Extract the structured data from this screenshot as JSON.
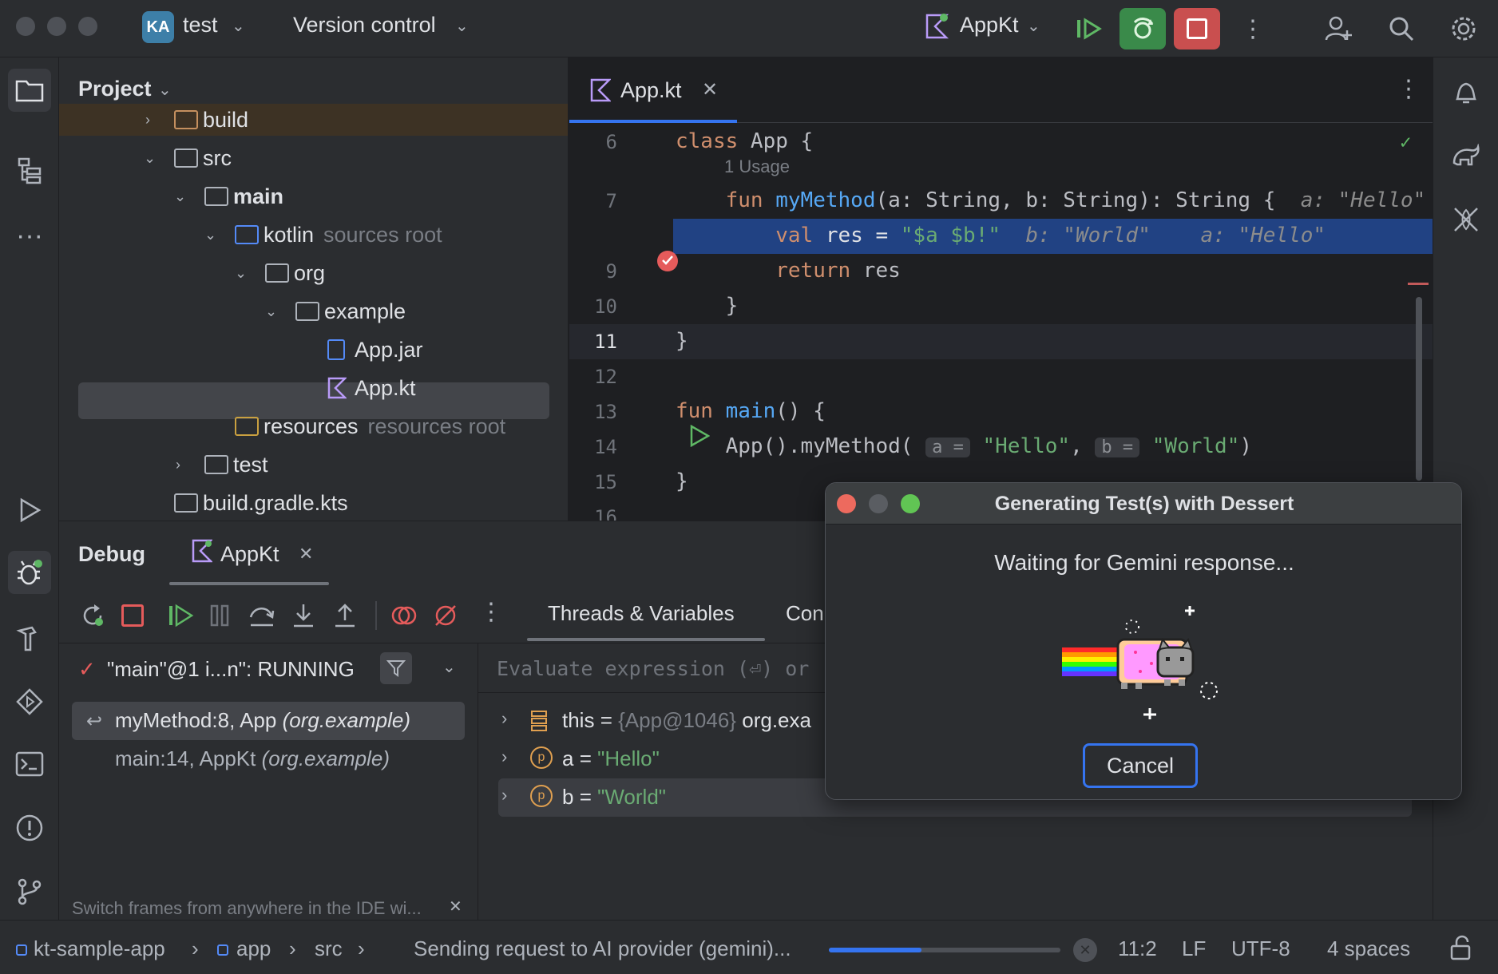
{
  "titlebar": {
    "project_badge": "KA",
    "project_name": "test",
    "vcs_label": "Version control",
    "run_config": "AppKt"
  },
  "project_panel": {
    "title": "Project",
    "tree": [
      {
        "label": "build",
        "hint": ""
      },
      {
        "label": "src",
        "hint": ""
      },
      {
        "label": "main",
        "hint": ""
      },
      {
        "label": "kotlin",
        "hint": "sources root"
      },
      {
        "label": "org",
        "hint": ""
      },
      {
        "label": "example",
        "hint": ""
      },
      {
        "label": "App.jar",
        "hint": ""
      },
      {
        "label": "App.kt",
        "hint": ""
      },
      {
        "label": "resources",
        "hint": "resources root"
      },
      {
        "label": "test",
        "hint": ""
      },
      {
        "label": "build.gradle.kts",
        "hint": ""
      }
    ]
  },
  "editor": {
    "tab_label": "App.kt",
    "usage_hint": "1 Usage",
    "lines": {
      "n6": "6",
      "n7": "7",
      "n9": "9",
      "n10": "10",
      "n11": "11",
      "n12": "12",
      "n13": "13",
      "n14": "14",
      "n15": "15",
      "n16": "16"
    },
    "inline_hints": {
      "l7_a": "a: \"Hello\"",
      "l8_b": "b: \"World\"",
      "l8_a": "a: \"Hello\"",
      "l14_a": "a =",
      "l14_b": "b ="
    }
  },
  "debug": {
    "title": "Debug",
    "session_tab": "AppKt",
    "threads_tab": "Threads & Variables",
    "console_tab": "Con",
    "thread_status": "\"main\"@1 i...n\": RUNNING",
    "eval_placeholder": "Evaluate expression (⏎) or",
    "frames": [
      {
        "method": "myMethod:8, App",
        "pkg": "(org.example)"
      },
      {
        "method": "main:14, AppKt",
        "pkg": "(org.example)"
      }
    ],
    "variables": [
      {
        "name": "this",
        "eq": "=",
        "value_gray": "{App@1046}",
        "value": "org.exa"
      },
      {
        "name": "a",
        "eq": "=",
        "value": "\"Hello\""
      },
      {
        "name": "b",
        "eq": "=",
        "value": "\"World\""
      }
    ],
    "tip": "Switch frames from anywhere in the IDE wi..."
  },
  "dialog": {
    "title": "Generating Test(s) with Dessert",
    "message": "Waiting for Gemini response...",
    "cancel_label": "Cancel"
  },
  "statusbar": {
    "crumb1": "kt-sample-app",
    "crumb2": "app",
    "crumb3": "src",
    "task": "Sending request to AI provider (gemini)...",
    "progress": 0.4,
    "position": "11:2",
    "line_sep": "LF",
    "encoding": "UTF-8",
    "indent": "4 spaces"
  },
  "colors": {
    "accent_blue": "#3574f0",
    "selection": "#214283",
    "debug_green": "#3a8a4a",
    "stop_red": "#c94f4f"
  }
}
